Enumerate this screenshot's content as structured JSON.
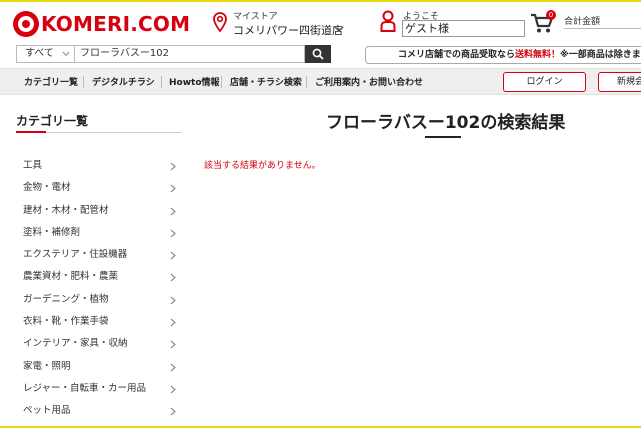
{
  "header": {
    "logo_text": "KOMERI.COM",
    "mystore_label": "マイストア",
    "mystore_name": "コメリパワー四街道店",
    "welcome_label": "ようこそ",
    "guest_name": "ゲスト様",
    "cart_count": "0",
    "total_label": "合計金額"
  },
  "search": {
    "scope": "すべて",
    "query": "フローラバスー102",
    "promo_prefix": "コメリ店舗での商品受取なら",
    "promo_free": "送料無料！",
    "promo_suffix": "※一部商品は除きます"
  },
  "nav": {
    "items": [
      "カテゴリ一覧",
      "デジタルチラシ",
      "Howto情報",
      "店舗・チラシ検索",
      "ご利用案内・お問い合わせ"
    ],
    "login": "ログイン",
    "register": "新規会員"
  },
  "sidebar": {
    "title": "カテゴリ一覧",
    "categories": [
      "工具",
      "金物・電材",
      "建材・木材・配管材",
      "塗料・補修剤",
      "エクステリア・住設機器",
      "農業資材・肥料・農薬",
      "ガーデニング・植物",
      "衣料・靴・作業手袋",
      "インテリア・家具・収納",
      "家電・照明",
      "レジャー・自転車・カー用品",
      "ペット用品"
    ]
  },
  "main": {
    "title": "フローラバスー102の検索結果",
    "no_result": "該当する結果がありません。"
  },
  "colors": {
    "brand_red": "#d7000f",
    "accent_yellow": "#e8d80a",
    "nav_bg": "#efefef"
  }
}
